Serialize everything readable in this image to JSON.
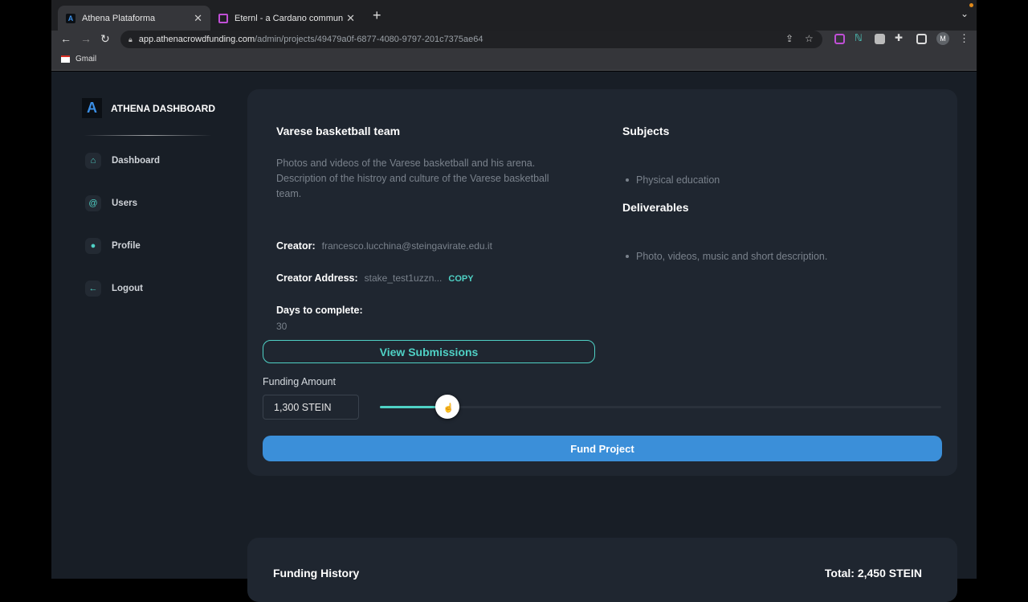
{
  "browser": {
    "tabs": [
      {
        "title": "Athena Plataforma",
        "active": true
      },
      {
        "title": "Eternl - a Cardano community",
        "active": false
      }
    ],
    "url_host": "app.athenacrowdfunding.com",
    "url_path": "/admin/projects/49479a0f-6877-4080-9797-201c7375ae64",
    "avatar_initial": "M",
    "bookmarks": [
      {
        "label": "Gmail"
      }
    ]
  },
  "sidebar": {
    "logo_letter": "A",
    "brand": "ATHENA DASHBOARD",
    "items": [
      {
        "label": "Dashboard",
        "icon": "home-icon"
      },
      {
        "label": "Users",
        "icon": "at-icon"
      },
      {
        "label": "Profile",
        "icon": "person-icon"
      },
      {
        "label": "Logout",
        "icon": "arrow-left-icon"
      }
    ]
  },
  "project": {
    "title": "Varese basketball team",
    "description": "Photos and videos of the Varese basketball and his arena. Description of the histroy and culture of the Varese basketball team.",
    "creator_label": "Creator:",
    "creator": "francesco.lucchina@steingavirate.edu.it",
    "address_label": "Creator Address:",
    "address": "stake_test1uzzn...",
    "copy_label": "COPY",
    "days_label": "Days to complete:",
    "days": "30",
    "subjects_title": "Subjects",
    "subjects": [
      "Physical education"
    ],
    "deliverables_title": "Deliverables",
    "deliverables": [
      "Photo, videos, music and short description."
    ]
  },
  "funding": {
    "view_submissions_label": "View Submissions",
    "amount_label": "Funding Amount",
    "amount_value": "1,300 STEIN",
    "slider_fraction": 0.12,
    "fund_button_label": "Fund Project"
  },
  "history": {
    "title": "Funding History",
    "total": "Total: 2,450 STEIN"
  },
  "colors": {
    "accent_teal": "#4fd1c5",
    "primary_blue": "#3b8fd9",
    "page_bg": "#181e26",
    "card_bg": "#1f2630"
  }
}
